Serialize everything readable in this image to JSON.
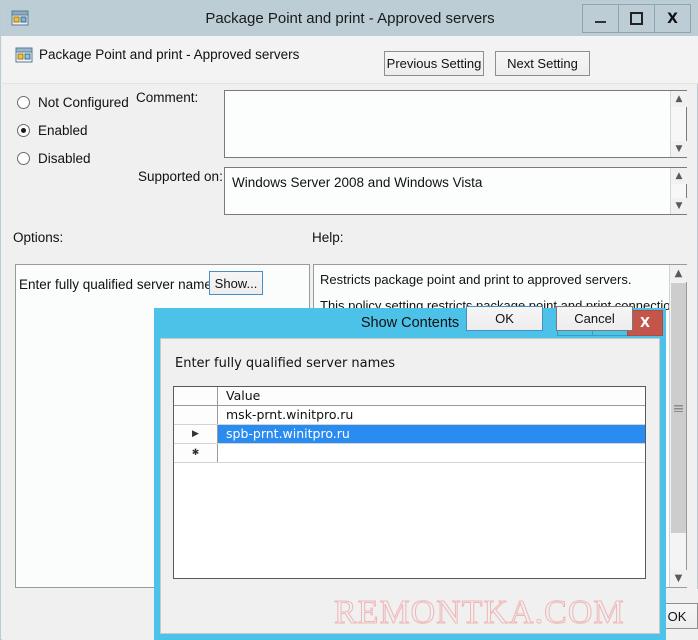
{
  "window": {
    "title": "Package Point and print - Approved servers",
    "icon": "policy-setting-icon",
    "minimize_label": "",
    "maximize_label": "",
    "close_label": "X"
  },
  "header": {
    "setting_name": "Package Point and print - Approved servers",
    "previous_setting_label": "Previous Setting",
    "next_setting_label": "Next Setting"
  },
  "state": {
    "not_configured_label": "Not Configured",
    "enabled_label": "Enabled",
    "disabled_label": "Disabled",
    "selected": "Enabled"
  },
  "fields": {
    "comment_label": "Comment:",
    "comment_value": "",
    "supported_on_label": "Supported on:",
    "supported_on_value": "Windows Server 2008 and Windows Vista"
  },
  "panes": {
    "options_label": "Options:",
    "help_label": "Help:",
    "option_item_label": "Enter fully qualified server names",
    "show_button_label": "Show...",
    "help_line_1": "Restricts package point and print to approved servers.",
    "help_line_2": "This policy setting restricts package point and print connections"
  },
  "main_buttons": {
    "ok_label": "OK"
  },
  "dialog": {
    "title": "Show Contents",
    "minimize_label": "",
    "maximize_label": "",
    "close_label": "X",
    "list_label": "Enter fully qualified server names",
    "grid": {
      "columns": [
        "",
        "Value"
      ],
      "rows": [
        {
          "marker": "",
          "value": "msk-prnt.winitpro.ru",
          "selected": false
        },
        {
          "marker": "▶",
          "value": "spb-prnt.winitpro.ru",
          "selected": true
        },
        {
          "marker": "✱",
          "value": "",
          "selected": false
        }
      ]
    },
    "ok_label": "OK",
    "cancel_label": "Cancel"
  },
  "watermark": {
    "text": "REMONTKA.COM"
  },
  "colors": {
    "main_titlebar": "#bccdd6",
    "dialog_titlebar": "#4cc2e8",
    "dialog_close": "#c4554b",
    "selection": "#2a8cf0",
    "watermark": "#f0b6b6"
  }
}
